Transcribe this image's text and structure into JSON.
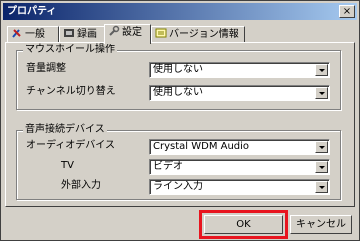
{
  "window": {
    "title": "プロパティ",
    "close_label": "×"
  },
  "tabs": [
    {
      "label": "一般"
    },
    {
      "label": "録画"
    },
    {
      "label": "設定"
    },
    {
      "label": "バージョン情報"
    }
  ],
  "mouse_wheel": {
    "title": "マウスホイール操作",
    "volume_label": "音量調整",
    "volume_value": "使用しない",
    "channel_label": "チャンネル切り替え",
    "channel_value": "使用しない"
  },
  "audio": {
    "title": "音声接続デバイス",
    "device_label": "オーディオデバイス",
    "device_value": "Crystal WDM Audio",
    "tv_label": "TV",
    "tv_value": "ビデオ",
    "ext_label": "外部入力",
    "ext_value": "ライン入力"
  },
  "buttons": {
    "ok": "OK",
    "cancel": "キャンセル"
  },
  "colors": {
    "highlight": "#e8141e",
    "titlebar": "#0a246a"
  }
}
